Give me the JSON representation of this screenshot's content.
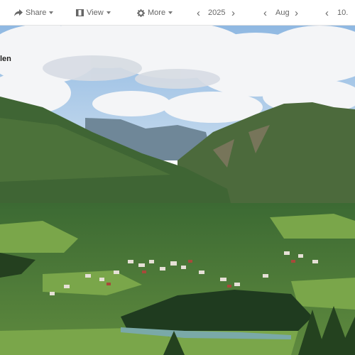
{
  "toolbar": {
    "share_label": "Share",
    "view_label": "View",
    "more_label": "More",
    "year_value": "2025",
    "month_value": "Aug",
    "day_value": "10."
  },
  "photo": {
    "caption": "len",
    "description_icons": [
      "share-icon",
      "view-icon",
      "gear-icon",
      "chevron-left-icon",
      "chevron-right-icon"
    ]
  },
  "colors": {
    "toolbar_bg": "#ffffff",
    "toolbar_text": "#666666",
    "sky": "#9ec3e6"
  }
}
